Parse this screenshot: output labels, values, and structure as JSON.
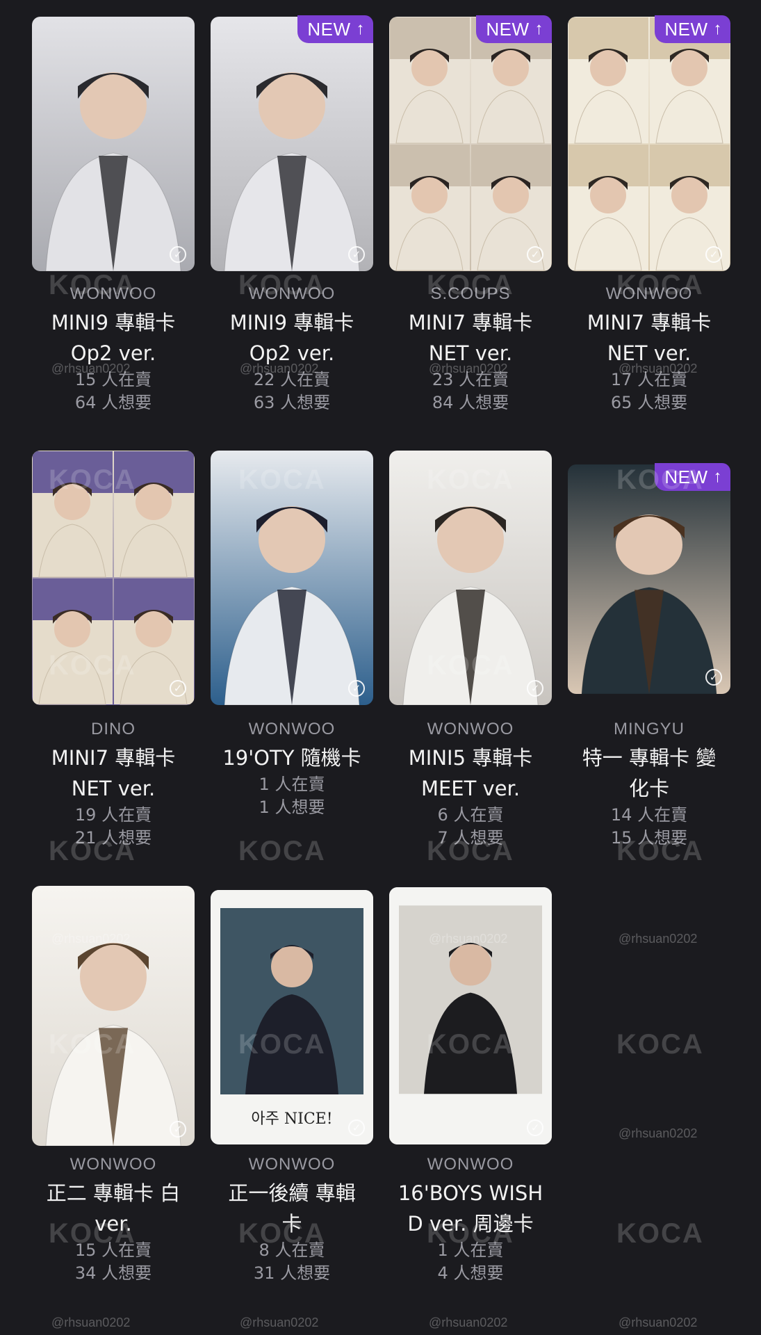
{
  "badge": {
    "new_label": "NEW",
    "new_arrow": "↑"
  },
  "check_glyph": "✓",
  "watermark": {
    "logo": "KOCA",
    "handle": "@rhsuan0202"
  },
  "cards": [
    {
      "member": "WONWOO",
      "title": "MINI9 專輯卡",
      "subtitle": "Op2 ver.",
      "selling": "15 人在賣",
      "wanting": "64 人想要",
      "is_new": false,
      "palette": [
        "#a9aab0",
        "#e2e2e6",
        "#2a2a2e"
      ]
    },
    {
      "member": "WONWOO",
      "title": "MINI9 專輯卡",
      "subtitle": "Op2 ver.",
      "selling": "22 人在賣",
      "wanting": "63 人想要",
      "is_new": true,
      "palette": [
        "#b2b2b6",
        "#e6e6ea",
        "#2b2b2f"
      ]
    },
    {
      "member": "S.COUPS",
      "title": "MINI7 專輯卡",
      "subtitle": "NET ver.",
      "selling": "23 人在賣",
      "wanting": "84 人想要",
      "is_new": true,
      "palette": [
        "#cbbfae",
        "#e9e2d6",
        "#2a2422"
      ]
    },
    {
      "member": "WONWOO",
      "title": "MINI7 專輯卡",
      "subtitle": "NET ver.",
      "selling": "17 人在賣",
      "wanting": "65 人想要",
      "is_new": true,
      "palette": [
        "#d7c8ac",
        "#f1ebdd",
        "#2e2823"
      ]
    },
    {
      "member": "DINO",
      "title": "MINI7 專輯卡",
      "subtitle": "NET ver.",
      "selling": "19 人在賣",
      "wanting": "21 人想要",
      "is_new": false,
      "palette": [
        "#6a5e98",
        "#e5dccb",
        "#3a2c25"
      ]
    },
    {
      "member": "WONWOO",
      "title": "19'OTY 隨機卡",
      "subtitle": "",
      "selling": "1 人在賣",
      "wanting": "1 人想要",
      "is_new": false,
      "palette": [
        "#2d5f8c",
        "#e7eaee",
        "#1c1e2c"
      ]
    },
    {
      "member": "WONWOO",
      "title": "MINI5 專輯卡",
      "subtitle": "MEET ver.",
      "selling": "6 人在賣",
      "wanting": "7 人想要",
      "is_new": false,
      "palette": [
        "#c8c4bf",
        "#f0efec",
        "#2b2622"
      ]
    },
    {
      "member": "MINGYU",
      "title": "特一 專輯卡 變",
      "subtitle": "化卡",
      "selling": "14 人在賣",
      "wanting": "15 人想要",
      "is_new": true,
      "palette": [
        "#d9c7b4",
        "#243139",
        "#4a3220"
      ]
    },
    {
      "member": "WONWOO",
      "title": "正二 專輯卡 白",
      "subtitle": "ver.",
      "selling": "15 人在賣",
      "wanting": "34 人想要",
      "is_new": false,
      "palette": [
        "#ded9d1",
        "#f6f4f0",
        "#5b4530"
      ]
    },
    {
      "member": "WONWOO",
      "title": "正一後續 專輯",
      "subtitle": "卡",
      "selling": "8 人在賣",
      "wanting": "31 人想要",
      "is_new": false,
      "palette": [
        "#3e5563",
        "#f2f2f2",
        "#1d1f2a"
      ],
      "caption": "아주 NICE!"
    },
    {
      "member": "WONWOO",
      "title": "16'BOYS WISH",
      "subtitle": "D ver. 周邊卡",
      "selling": "1 人在賣",
      "wanting": "4 人想要",
      "is_new": false,
      "palette": [
        "#d6d3cd",
        "#f2f1ee",
        "#1c1c1f"
      ]
    }
  ]
}
